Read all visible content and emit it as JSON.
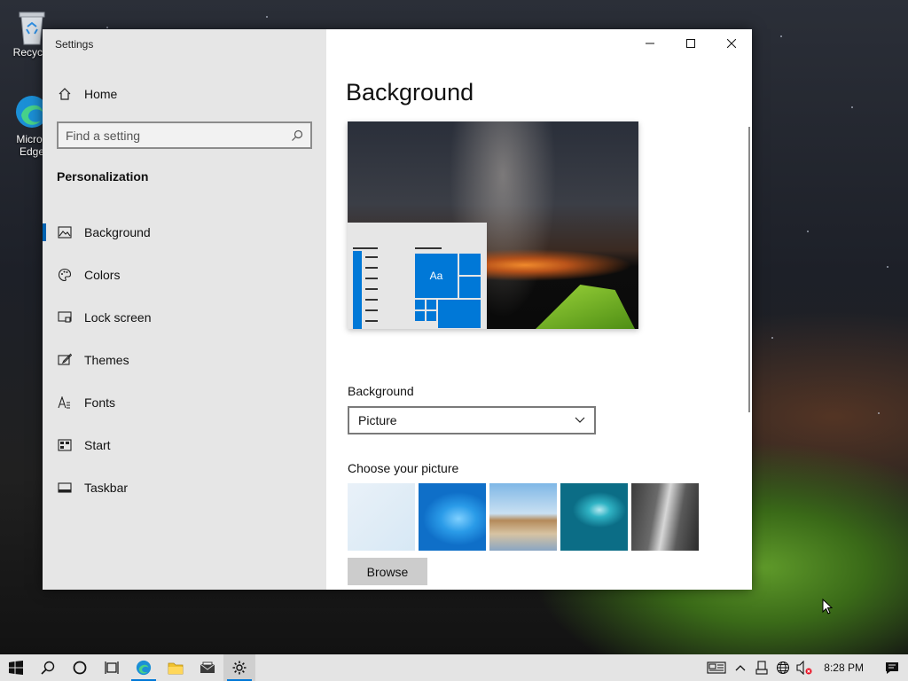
{
  "desktop": {
    "icons": [
      {
        "label": "Recycle",
        "icon": "recycle-bin-icon"
      },
      {
        "label": "Micros\nEdge",
        "icon": "edge-icon"
      }
    ]
  },
  "window": {
    "title": "Settings",
    "controls": {
      "minimize": "minimize-icon",
      "maximize": "maximize-icon",
      "close": "close-icon"
    }
  },
  "sidebar": {
    "home_label": "Home",
    "search_placeholder": "Find a setting",
    "section_title": "Personalization",
    "items": [
      {
        "label": "Background",
        "icon": "picture-icon",
        "active": true
      },
      {
        "label": "Colors",
        "icon": "palette-icon",
        "active": false
      },
      {
        "label": "Lock screen",
        "icon": "lock-screen-icon",
        "active": false
      },
      {
        "label": "Themes",
        "icon": "brush-icon",
        "active": false
      },
      {
        "label": "Fonts",
        "icon": "font-icon",
        "active": false
      },
      {
        "label": "Start",
        "icon": "start-icon",
        "active": false
      },
      {
        "label": "Taskbar",
        "icon": "taskbar-icon",
        "active": false
      }
    ]
  },
  "main": {
    "title": "Background",
    "preview": {
      "sample_text": "Aa"
    },
    "background_label": "Background",
    "background_value": "Picture",
    "choose_label": "Choose your picture",
    "browse_label": "Browse"
  },
  "taskbar": {
    "clock": "8:28 PM",
    "accent": "#0078d7"
  }
}
